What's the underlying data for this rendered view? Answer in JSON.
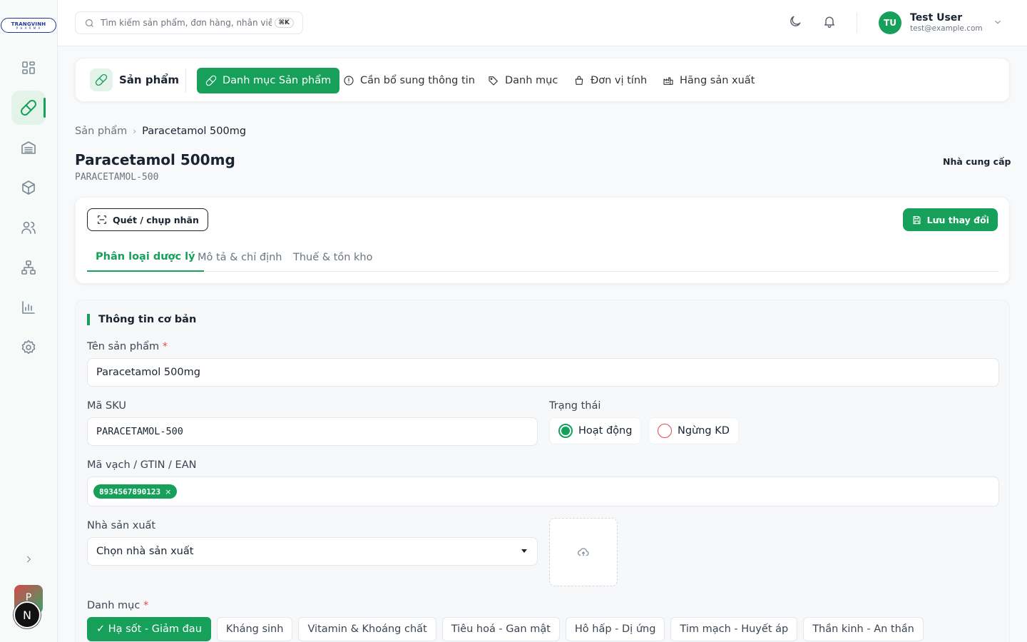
{
  "logo": {
    "text": "TRANGVINH",
    "sub": "P H A R M A"
  },
  "header": {
    "search_placeholder": "Tìm kiếm sản phẩm, đơn hàng, nhân viên...",
    "shortcut": "⌘K",
    "user": {
      "initials": "TU",
      "name": "Test User",
      "email": "test@example.com"
    }
  },
  "sidebar": {
    "items": [
      "dashboard-icon",
      "pill-icon",
      "warehouse-icon",
      "box-icon",
      "users-icon",
      "org-chart-icon",
      "chart-icon",
      "gear-icon"
    ],
    "active_index": 1,
    "avatar_p": "P",
    "avatar_n": "N"
  },
  "subnav": {
    "brand": "Sản phẩm",
    "tabs": [
      "Danh mục Sản phẩm",
      "Cần bổ sung thông tin",
      "Danh mục",
      "Đơn vị tính",
      "Hãng sản xuất"
    ]
  },
  "breadcrumb": {
    "parent": "Sản phẩm",
    "current": "Paracetamol 500mg"
  },
  "product": {
    "title": "Paracetamol 500mg",
    "sku": "PARACETAMOL-500",
    "supplier_label": "Nhà cung cấp"
  },
  "actions": {
    "scan": "Quét / chụp nhãn",
    "save": "Lưu thay đổi"
  },
  "form_tabs": [
    "Phân loại dược lý",
    "Mô tả & chỉ định",
    "Thuế & tồn kho"
  ],
  "form": {
    "section_title": "Thông tin cơ bản",
    "name_label": "Tên sản phẩm",
    "name_value": "Paracetamol 500mg",
    "sku_label": "Mã SKU",
    "sku_value": "PARACETAMOL-500",
    "status_label": "Trạng thái",
    "status_active": "Hoạt động",
    "status_inactive": "Ngừng KD",
    "barcode_label": "Mã vạch / GTIN / EAN",
    "barcode_value": "8934567890123",
    "barcode_remove": "×",
    "manufacturer_label": "Nhà sản xuất",
    "manufacturer_placeholder": "Chọn nhà sản xuất",
    "category_label": "Danh mục",
    "required_mark": "*",
    "categories": [
      "✓ Hạ sốt - Giảm đau",
      "Kháng sinh",
      "Vitamin & Khoáng chất",
      "Tiêu hoá - Gan mật",
      "Hô hấp - Dị ứng",
      "Tim mạch - Huyết áp",
      "Thần kinh - An thần"
    ]
  },
  "colors": {
    "accent": "#16a05a",
    "danger": "#e5484d",
    "text": "#1a2330",
    "muted": "#6b7580"
  }
}
